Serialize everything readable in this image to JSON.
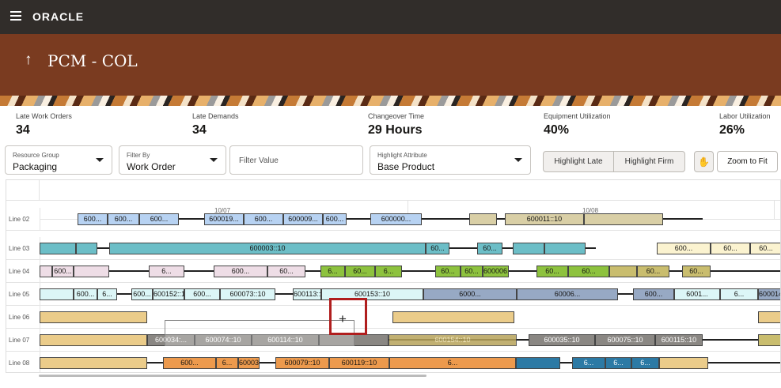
{
  "app": {
    "logo": "ORACLE",
    "page_title": "PCM - COL",
    "back_icon": "↑"
  },
  "kpis": [
    {
      "label": "Late Work Orders",
      "value": "34"
    },
    {
      "label": "Late Demands",
      "value": "34"
    },
    {
      "label": "Changeover Time",
      "value": "29 Hours"
    },
    {
      "label": "Equipment Utilization",
      "value": "40%"
    },
    {
      "label": "Labor Utilization",
      "value": "26%"
    }
  ],
  "filters": {
    "resource_group": {
      "label": "Resource Group",
      "value": "Packaging"
    },
    "filter_by": {
      "label": "Filter By",
      "value": "Work Order"
    },
    "filter_value": {
      "placeholder": "Filter Value"
    },
    "highlight_attribute": {
      "label": "Highlight Attribute",
      "value": "Base Product"
    }
  },
  "toolbar": {
    "highlight_late": "Highlight Late",
    "highlight_firm": "Highlight Firm",
    "zoom_to_fit": "Zoom to Fit",
    "pan_icon": "✋"
  },
  "timeline": {
    "dates": [
      "10/07",
      "10/08"
    ]
  },
  "colors": {
    "blue": "#b7d2f2",
    "tan": "#d9cfa6",
    "teal": "#6cbec7",
    "cream": "#fbf3d0",
    "pink": "#eedde6",
    "olive": "#c9bd6e",
    "green": "#8dc23e",
    "lightcyan": "#dcf6f7",
    "slate": "#97a9c4",
    "sand": "#ebcc8a",
    "gray": "#8a8783",
    "orange": "#ed9a4d",
    "darkblue": "#2c7aa5",
    "ghost": "#b7a35a"
  },
  "rows": [
    {
      "label": "Line 02",
      "bars": [
        {
          "text": "600...",
          "color": "blue"
        },
        {
          "text": "600...",
          "color": "blue"
        },
        {
          "text": "600...",
          "color": "blue"
        },
        {
          "text": "600019...",
          "color": "blue"
        },
        {
          "text": "600...",
          "color": "blue"
        },
        {
          "text": "600009...",
          "color": "blue"
        },
        {
          "text": "600...",
          "color": "blue"
        },
        {
          "text": "600000...",
          "color": "blue"
        },
        {
          "text": "",
          "color": "tan"
        },
        {
          "text": "600011::10",
          "color": "tan"
        },
        {
          "text": "",
          "color": "tan"
        }
      ]
    },
    {
      "label": "Line 03",
      "bars": [
        {
          "text": "",
          "color": "teal"
        },
        {
          "text": "",
          "color": "teal"
        },
        {
          "text": "600003::10",
          "color": "teal"
        },
        {
          "text": "60...",
          "color": "teal"
        },
        {
          "text": "60...",
          "color": "teal"
        },
        {
          "text": "",
          "color": "teal"
        },
        {
          "text": "",
          "color": "teal"
        },
        {
          "text": "600...",
          "color": "cream"
        },
        {
          "text": "60...",
          "color": "cream"
        },
        {
          "text": "60...",
          "color": "cream"
        }
      ]
    },
    {
      "label": "Line 04",
      "bars": [
        {
          "text": "",
          "color": "pink"
        },
        {
          "text": "600...",
          "color": "pink"
        },
        {
          "text": "",
          "color": "pink"
        },
        {
          "text": "6...",
          "color": "pink"
        },
        {
          "text": "600...",
          "color": "pink"
        },
        {
          "text": "60...",
          "color": "pink"
        },
        {
          "text": "6...",
          "color": "green"
        },
        {
          "text": "60...",
          "color": "green"
        },
        {
          "text": "6...",
          "color": "green"
        },
        {
          "text": "60...",
          "color": "green"
        },
        {
          "text": "60...",
          "color": "green"
        },
        {
          "text": "600006...",
          "color": "green"
        },
        {
          "text": "60...",
          "color": "green"
        },
        {
          "text": "60...",
          "color": "green"
        },
        {
          "text": "",
          "color": "olive"
        },
        {
          "text": "60...",
          "color": "olive"
        },
        {
          "text": "60...",
          "color": "olive"
        }
      ]
    },
    {
      "label": "Line 05",
      "bars": [
        {
          "text": "",
          "color": "lightcyan"
        },
        {
          "text": "600...",
          "color": "lightcyan"
        },
        {
          "text": "6...",
          "color": "lightcyan"
        },
        {
          "text": "600...",
          "color": "lightcyan"
        },
        {
          "text": "600152::10",
          "color": "lightcyan"
        },
        {
          "text": "600...",
          "color": "lightcyan"
        },
        {
          "text": "600073::10",
          "color": "lightcyan"
        },
        {
          "text": "600113::10",
          "color": "lightcyan"
        },
        {
          "text": "600153::10",
          "color": "lightcyan"
        },
        {
          "text": "6000...",
          "color": "slate"
        },
        {
          "text": "60006...",
          "color": "slate"
        },
        {
          "text": "600...",
          "color": "slate"
        },
        {
          "text": "6001...",
          "color": "lightcyan"
        },
        {
          "text": "6...",
          "color": "lightcyan"
        },
        {
          "text": "600014",
          "color": "slate"
        }
      ]
    },
    {
      "label": "Line 06",
      "bars": [
        {
          "text": "",
          "color": "sand"
        },
        {
          "text": "",
          "color": "sand"
        },
        {
          "text": "",
          "color": "sand"
        }
      ]
    },
    {
      "label": "Line 07",
      "bars": [
        {
          "text": "",
          "color": "sand"
        },
        {
          "text": "600034:...",
          "color": "gray"
        },
        {
          "text": "600074::10",
          "color": "gray"
        },
        {
          "text": "600114::10",
          "color": "gray"
        },
        {
          "text": "",
          "color": "gray"
        },
        {
          "text": "600154::10",
          "color": "ghost"
        },
        {
          "text": "600035::10",
          "color": "gray"
        },
        {
          "text": "600075::10",
          "color": "gray"
        },
        {
          "text": "600115::10",
          "color": "gray"
        },
        {
          "text": "",
          "color": "olive"
        }
      ]
    },
    {
      "label": "Line 08",
      "bars": [
        {
          "text": "",
          "color": "sand"
        },
        {
          "text": "600...",
          "color": "orange"
        },
        {
          "text": "6...",
          "color": "orange"
        },
        {
          "text": "600039::10",
          "color": "orange"
        },
        {
          "text": "600079::10",
          "color": "orange"
        },
        {
          "text": "600119::10",
          "color": "orange"
        },
        {
          "text": "6...",
          "color": "orange"
        },
        {
          "text": "",
          "color": "darkblue"
        },
        {
          "text": "6...",
          "color": "darkblue"
        },
        {
          "text": "6...",
          "color": "darkblue"
        },
        {
          "text": "6...",
          "color": "darkblue"
        },
        {
          "text": "",
          "color": "sand"
        }
      ]
    }
  ]
}
